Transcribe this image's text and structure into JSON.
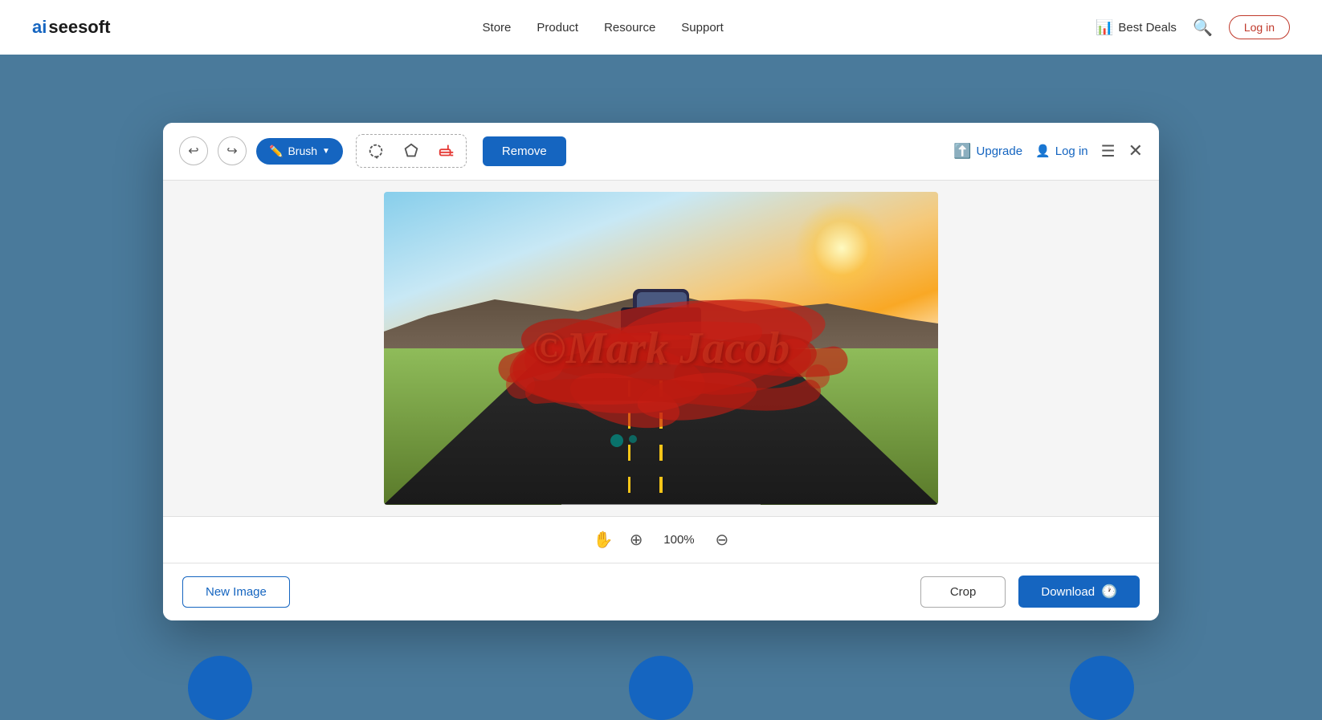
{
  "navbar": {
    "logo": "aiseesoft",
    "logo_ai": "ai",
    "logo_rest": "seesoft",
    "links": [
      "Store",
      "Product",
      "Resource",
      "Support"
    ],
    "best_deals_label": "Best Deals",
    "login_label": "Log in"
  },
  "toolbar": {
    "brush_label": "Brush",
    "remove_label": "Remove",
    "upgrade_label": "Upgrade",
    "login_label": "Log in"
  },
  "canvas": {
    "watermark_text": "©Mark Jacob",
    "zoom_percent": "100%"
  },
  "footer": {
    "new_image_label": "New Image",
    "crop_label": "Crop",
    "download_label": "Download"
  }
}
